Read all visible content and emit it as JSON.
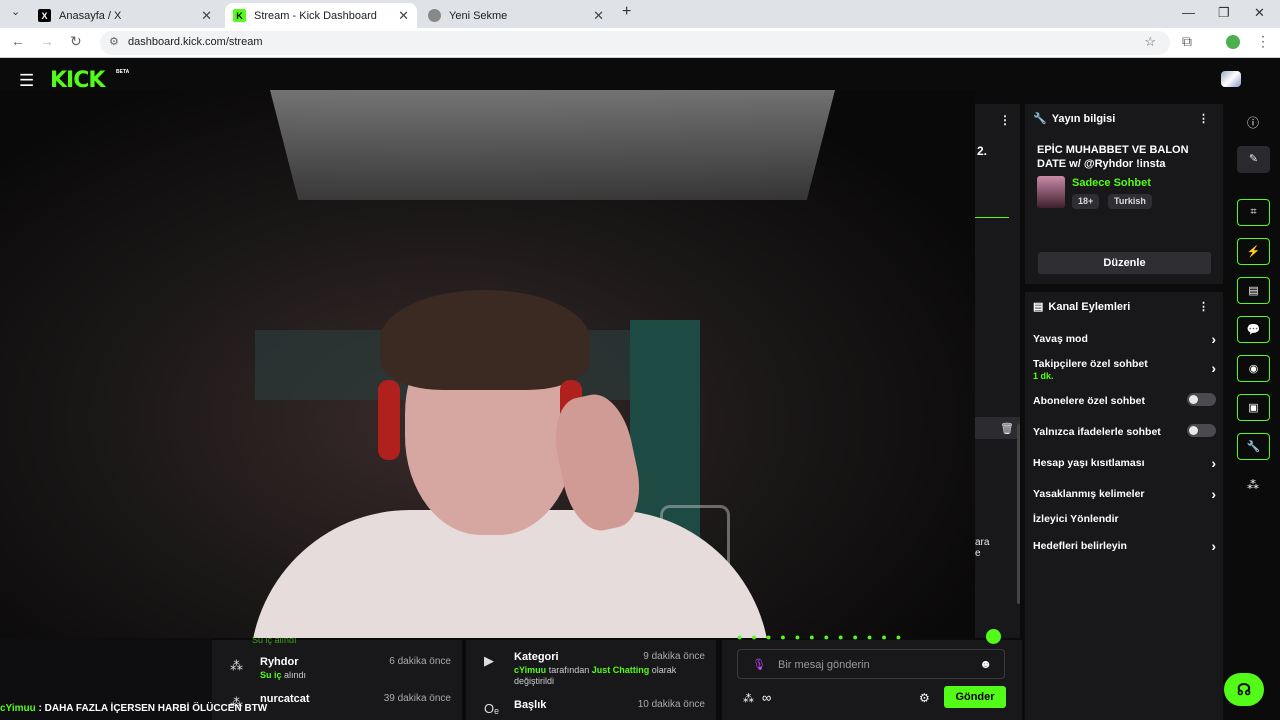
{
  "browser": {
    "tabs": [
      {
        "label": "Anasayfa / X",
        "favicon": "x-icon"
      },
      {
        "label": "Stream - Kick Dashboard",
        "favicon": "kick-icon"
      },
      {
        "label": "Yeni Sekme",
        "favicon": "chrome-icon"
      }
    ],
    "url": "dashboard.kick.com/stream"
  },
  "header": {
    "logo": "KICK",
    "beta": "BETA"
  },
  "middle": {
    "number": "2.",
    "text1": "ara",
    "text2": "e"
  },
  "stream_info": {
    "heading": "Yayın bilgisi",
    "title": "EPİC MUHABBET VE BALON DATE w/ @Ryhdor !insta",
    "category": "Sadece Sohbet",
    "tags": [
      "18+",
      "Turkish"
    ],
    "edit_label": "Düzenle"
  },
  "channel_actions": {
    "heading": "Kanal Eylemleri",
    "items": [
      {
        "label": "Yavaş mod",
        "control": "chevron"
      },
      {
        "label": "Takipçilere özel sohbet",
        "sub": "1 dk.",
        "control": "chevron"
      },
      {
        "label": "Abonelere özel sohbet",
        "control": "toggle",
        "on": false
      },
      {
        "label": "Yalnızca ifadelerle sohbet",
        "control": "toggle",
        "on": false
      },
      {
        "label": "Hesap yaşı kısıtlaması",
        "control": "chevron"
      },
      {
        "label": "Yasaklanmış kelimeler",
        "control": "chevron"
      },
      {
        "label": "İzleyici Yönlendir",
        "control": "none"
      },
      {
        "label": "Hedefleri belirleyin",
        "control": "chevron"
      }
    ]
  },
  "activity": {
    "left": [
      {
        "name": "Ryhdor",
        "time": "6 dakika önce",
        "action_highlight": "Su iç",
        "action_rest": " alındı"
      },
      {
        "name": "nurcatcat",
        "time": "39 dakika önce"
      }
    ],
    "right": [
      {
        "name": "Kategori",
        "time": "9 dakika önce",
        "user": "cYimuu",
        "mid": " tarafından ",
        "value": "Just Chatting",
        "rest": " olarak değiştirildi"
      },
      {
        "name": "Başlık",
        "time": "10 dakika önce"
      }
    ],
    "partial_top": "Su iç alındı"
  },
  "chat": {
    "placeholder": "Bir mesaj gönderin",
    "send_label": "Gönder"
  },
  "ticker": {
    "user": "cYimuu",
    "message": " : DAHA FAZLA İÇERSEN HARBİ ÖLÜCCEN BTW"
  },
  "colors": {
    "accent": "#53fc18",
    "background": "#0b0b0c",
    "panel": "#18181b"
  }
}
